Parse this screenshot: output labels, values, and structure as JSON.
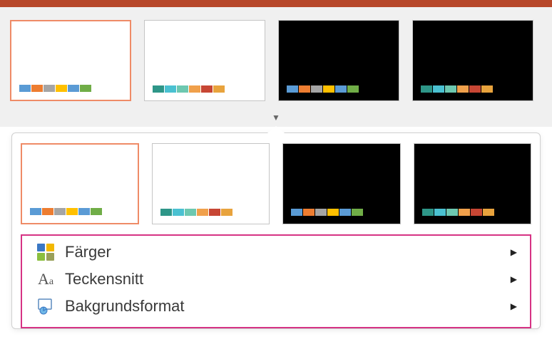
{
  "ribbon": {
    "variants": [
      {
        "selected": true,
        "bg": "light",
        "swatches": [
          "#5a9bd5",
          "#ed7d31",
          "#a5a5a5",
          "#ffc000",
          "#5b9bd5",
          "#70ad47"
        ]
      },
      {
        "selected": false,
        "bg": "light",
        "swatches": [
          "#2e9688",
          "#4ac1d1",
          "#6dc8b0",
          "#f0a04b",
          "#c74634",
          "#e8a33d"
        ]
      },
      {
        "selected": false,
        "bg": "dark",
        "swatches": [
          "#5a9bd5",
          "#ed7d31",
          "#a5a5a5",
          "#ffc000",
          "#5b9bd5",
          "#70ad47"
        ]
      },
      {
        "selected": false,
        "bg": "dark",
        "swatches": [
          "#2e9688",
          "#4ac1d1",
          "#6dc8b0",
          "#f0a04b",
          "#c74634",
          "#e8a33d"
        ]
      }
    ]
  },
  "dropdown": {
    "variants": [
      {
        "selected": true,
        "bg": "light",
        "swatches": [
          "#5a9bd5",
          "#ed7d31",
          "#a5a5a5",
          "#ffc000",
          "#5b9bd5",
          "#70ad47"
        ]
      },
      {
        "selected": false,
        "bg": "light",
        "swatches": [
          "#2e9688",
          "#4ac1d1",
          "#6dc8b0",
          "#f0a04b",
          "#c74634",
          "#e8a33d"
        ]
      },
      {
        "selected": false,
        "bg": "dark",
        "swatches": [
          "#5a9bd5",
          "#ed7d31",
          "#a5a5a5",
          "#ffc000",
          "#5b9bd5",
          "#70ad47"
        ]
      },
      {
        "selected": false,
        "bg": "dark",
        "swatches": [
          "#2e9688",
          "#4ac1d1",
          "#6dc8b0",
          "#f0a04b",
          "#c74634",
          "#e8a33d"
        ]
      }
    ],
    "menu": {
      "colors": "Färger",
      "fonts": "Teckensnitt",
      "background": "Bakgrundsformat"
    }
  }
}
